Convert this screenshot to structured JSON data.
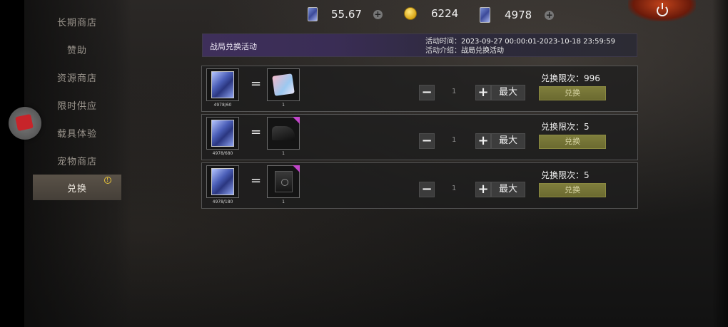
{
  "topbar": {
    "resources": [
      {
        "icon": "card-icon",
        "value": "55.67"
      },
      {
        "icon": "gold-coin-icon",
        "value": "6224"
      },
      {
        "icon": "exchange-card-icon",
        "value": "4978"
      }
    ]
  },
  "sidebar": {
    "items": [
      {
        "label": "长期商店"
      },
      {
        "label": "赞助"
      },
      {
        "label": "资源商店"
      },
      {
        "label": "限时供应"
      },
      {
        "label": "载具体验"
      },
      {
        "label": "宠物商店"
      },
      {
        "label": "兑换",
        "active": true,
        "badge": "!"
      }
    ]
  },
  "banner": {
    "title": "战局兑换活动",
    "time_label": "活动时间：",
    "time_value": "2023-09-27 00:00:01-2023-10-18 23:59:59",
    "desc_label": "活动介绍：",
    "desc_value": "战局兑换活动"
  },
  "rows": [
    {
      "cost_caption": "4978/60",
      "reward_icon": "gift-box-icon",
      "reward_caption": "1",
      "qty": "1",
      "limit_label": "兑换限次：",
      "limit_value": "996",
      "max_label": "最大",
      "exchange_label": "兑换"
    },
    {
      "cost_caption": "4978/680",
      "reward_icon": "piano-icon",
      "reward_caption": "1",
      "qty": "1",
      "limit_label": "兑换限次：",
      "limit_value": "5",
      "max_label": "最大",
      "exchange_label": "兑换"
    },
    {
      "cost_caption": "4978/180",
      "reward_icon": "safe-icon",
      "reward_caption": "1",
      "qty": "1",
      "limit_label": "兑换限次：",
      "limit_value": "5",
      "max_label": "最大",
      "exchange_label": "兑换"
    }
  ],
  "colors": {
    "accent_exchange": "#7f7e3c",
    "banner_purple": "#3e2f5a",
    "active_tab": "#5a5248"
  }
}
